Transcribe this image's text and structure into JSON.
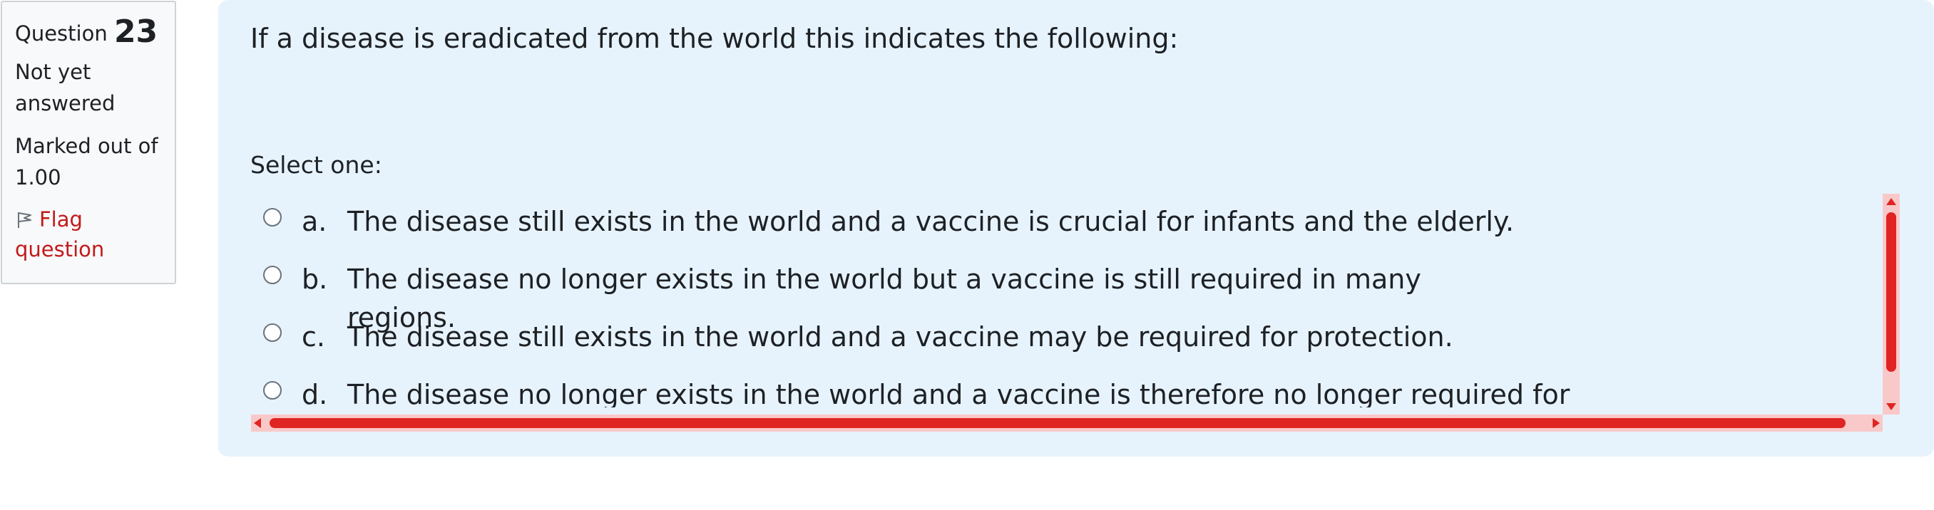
{
  "info": {
    "question_label": "Question",
    "question_number": "23",
    "state": "Not yet answered",
    "grade": "Marked out of 1.00",
    "flag_label": "Flag question",
    "flag_icon": "flag-icon",
    "flag_color": "#c21a1a"
  },
  "question": {
    "text": "If a disease is eradicated from the world this indicates the following:",
    "prompt": "Select one:",
    "options": [
      {
        "letter": "a.",
        "text": "The disease still exists in the world and a vaccine is crucial for infants and the elderly."
      },
      {
        "letter": "b.",
        "text": "The disease no longer exists in the world but a vaccine is still required in many regions."
      },
      {
        "letter": "c.",
        "text": "The disease still exists in the world and a vaccine may be required for protection."
      },
      {
        "letter": "d.",
        "text": "The disease no longer exists in the world and a vaccine is therefore no longer required for"
      }
    ]
  },
  "colors": {
    "content_bg": "#e7f3fc",
    "scrollbar_thumb": "#e02424",
    "scrollbar_track": "#f9c9c9"
  }
}
